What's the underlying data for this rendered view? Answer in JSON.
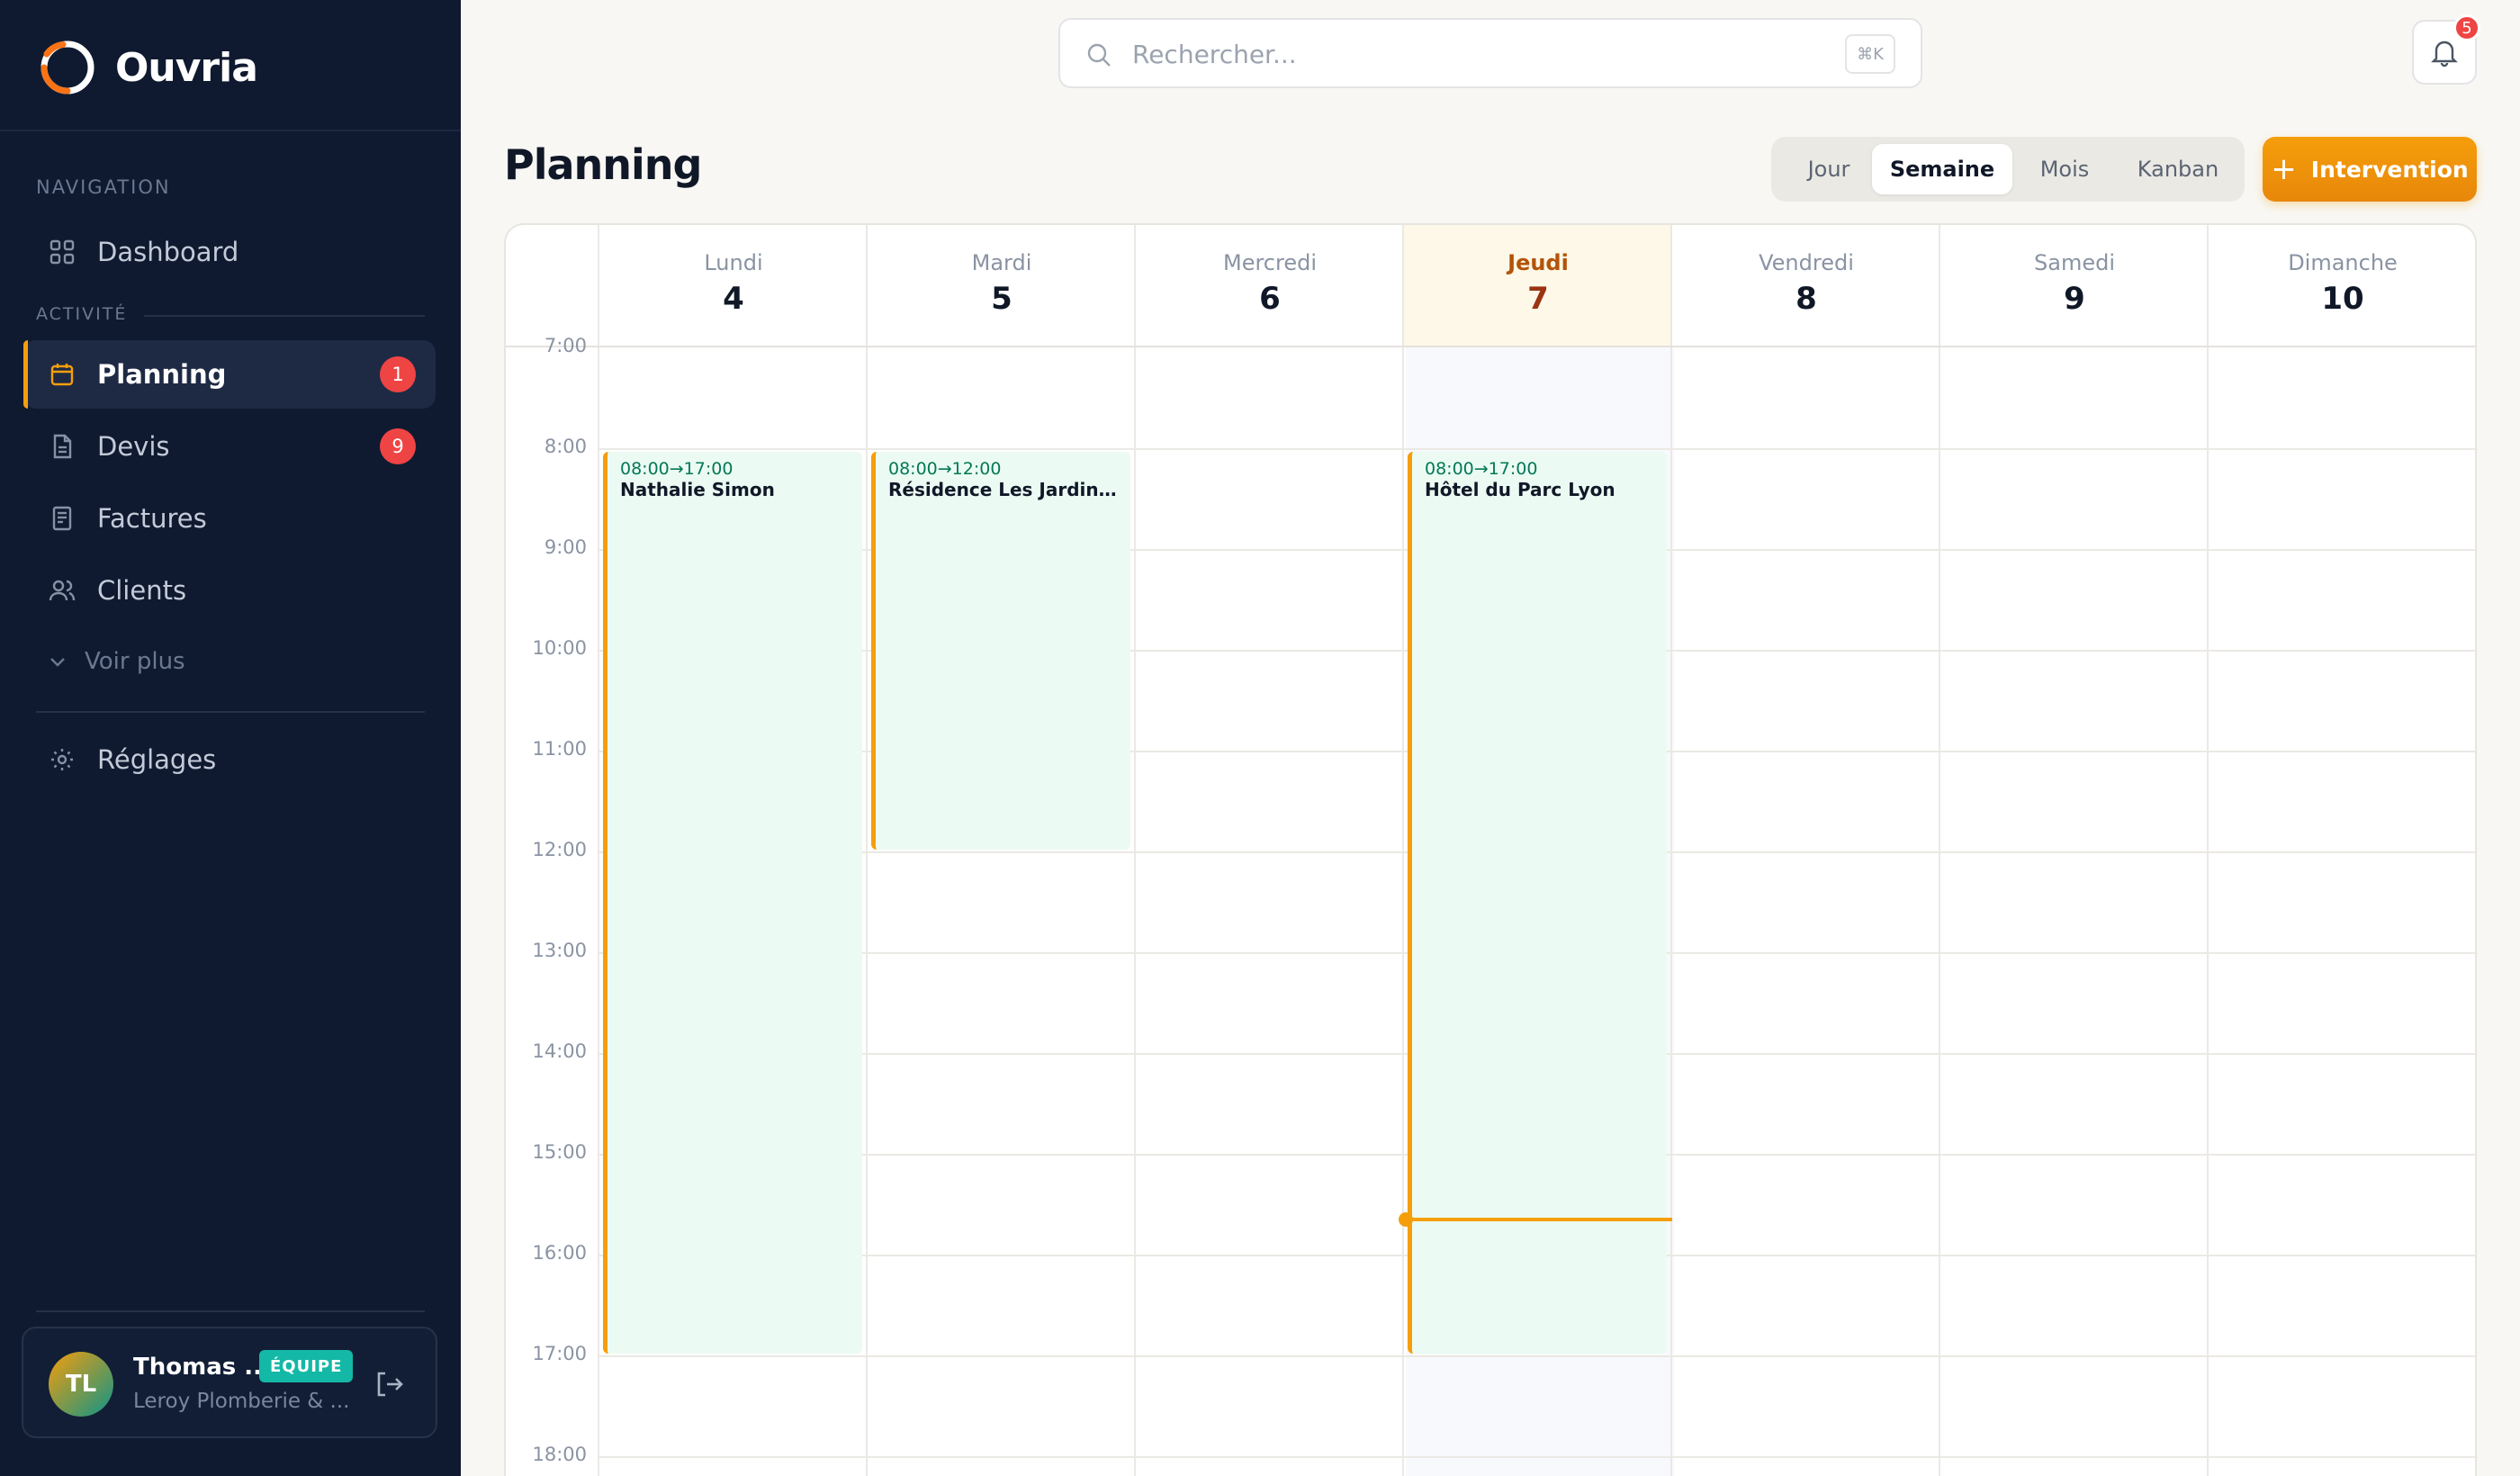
{
  "app": {
    "name": "Ouvria"
  },
  "sidebar": {
    "nav_section": "NAVIGATION",
    "activity_section": "ACTIVITÉ",
    "items": [
      {
        "label": "Dashboard",
        "icon": "grid-icon"
      },
      {
        "label": "Planning",
        "icon": "calendar-icon",
        "badge": "1",
        "active": true
      },
      {
        "label": "Devis",
        "icon": "document-icon",
        "badge": "9"
      },
      {
        "label": "Factures",
        "icon": "invoice-icon"
      },
      {
        "label": "Clients",
        "icon": "users-icon"
      }
    ],
    "more_label": "Voir plus",
    "settings_label": "Réglages",
    "user": {
      "initials": "TL",
      "name": "Thomas ...",
      "role": "ÉQUIPE",
      "company": "Leroy Plomberie & ..."
    }
  },
  "topbar": {
    "search_placeholder": "Rechercher...",
    "shortcut": "⌘K",
    "notifications_count": "5"
  },
  "page": {
    "title": "Planning",
    "views": [
      "Jour",
      "Semaine",
      "Mois",
      "Kanban"
    ],
    "active_view": "Semaine",
    "add_button": "Intervention"
  },
  "calendar": {
    "days": [
      {
        "name": "Lundi",
        "num": "4"
      },
      {
        "name": "Mardi",
        "num": "5"
      },
      {
        "name": "Mercredi",
        "num": "6"
      },
      {
        "name": "Jeudi",
        "num": "7",
        "today": true
      },
      {
        "name": "Vendredi",
        "num": "8"
      },
      {
        "name": "Samedi",
        "num": "9"
      },
      {
        "name": "Dimanche",
        "num": "10"
      }
    ],
    "hours": [
      "7:00",
      "8:00",
      "9:00",
      "10:00",
      "11:00",
      "12:00",
      "13:00",
      "14:00",
      "15:00",
      "16:00",
      "17:00",
      "18:00"
    ],
    "events": [
      {
        "day": "Lundi",
        "time": "08:00→17:00",
        "title": "Nathalie Simon"
      },
      {
        "day": "Mardi",
        "time": "08:00→12:00",
        "title": "Résidence Les Jardins du..."
      },
      {
        "day": "Jeudi",
        "time": "08:00→17:00",
        "title": "Hôtel du Parc Lyon"
      }
    ],
    "current_time": "15:40"
  },
  "colors": {
    "accent": "#f59e0b",
    "sidebar_bg": "#0f1a30",
    "event_bg": "#ebfbf3",
    "badge": "#ef4444",
    "role_badge": "#14b8a6"
  }
}
